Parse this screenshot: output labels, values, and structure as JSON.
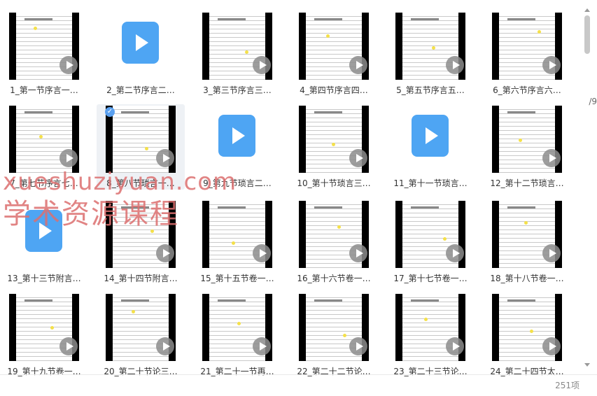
{
  "files": [
    {
      "label": "1_第一节序言一…",
      "type": "video"
    },
    {
      "label": "2_第二节序言二…",
      "type": "icon"
    },
    {
      "label": "3_第三节序言三…",
      "type": "video"
    },
    {
      "label": "4_第四节序言四…",
      "type": "video"
    },
    {
      "label": "5_第五节序言五…",
      "type": "video"
    },
    {
      "label": "6_第六节序言六…",
      "type": "video"
    },
    {
      "label": "7_第七节序言七…",
      "type": "video"
    },
    {
      "label": "8_第八节琐言一…",
      "type": "video",
      "selected": true
    },
    {
      "label": "9_第九节琐言二…",
      "type": "icon"
    },
    {
      "label": "10_第十节琐言三…",
      "type": "video"
    },
    {
      "label": "11_第十一节琐言…",
      "type": "icon"
    },
    {
      "label": "12_第十二节琐言…",
      "type": "video"
    },
    {
      "label": "13_第十三节附言…",
      "type": "icon"
    },
    {
      "label": "14_第十四节附言…",
      "type": "video"
    },
    {
      "label": "15_第十五节卷一…",
      "type": "video"
    },
    {
      "label": "16_第十六节卷一…",
      "type": "video"
    },
    {
      "label": "17_第十七节卷一…",
      "type": "video"
    },
    {
      "label": "18_第十八节卷一…",
      "type": "video"
    },
    {
      "label": "19_第十九节卷一…",
      "type": "video"
    },
    {
      "label": "20_第二十节论三…",
      "type": "video"
    },
    {
      "label": "21_第二十一节再…",
      "type": "video"
    },
    {
      "label": "22_第二十二节论…",
      "type": "video"
    },
    {
      "label": "23_第二十三节论…",
      "type": "video"
    },
    {
      "label": "24_第二十四节太…",
      "type": "video"
    }
  ],
  "watermark": {
    "line1": "xueshuziyuan.com",
    "line2": "学术资源课程"
  },
  "status": {
    "count": "251项"
  },
  "edge_text": "/9",
  "colors": {
    "accent": "#4ea5f3",
    "selected_bg": "#eef1f5",
    "watermark": "#dc6e6e"
  }
}
